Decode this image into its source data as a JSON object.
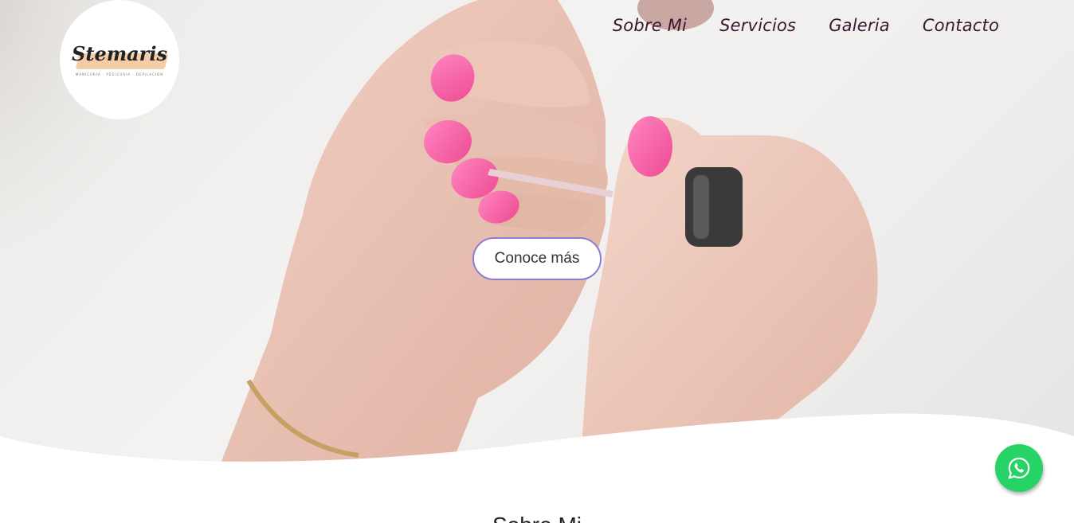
{
  "logo": {
    "wordmark": "Stemaris",
    "tagline": "MANICURIA · PEDICURIA · DEPILACION"
  },
  "nav": {
    "items": [
      {
        "label": "Sobre Mi"
      },
      {
        "label": "Servicios"
      },
      {
        "label": "Galeria"
      },
      {
        "label": "Contacto"
      }
    ]
  },
  "hero": {
    "cta_label": "Conoce más"
  },
  "next_section": {
    "title": "Sobre Mi"
  },
  "floating": {
    "whatsapp_icon": "whatsapp-icon"
  },
  "colors": {
    "nav_text": "#3b1730",
    "cta_border": "#8e7bd3",
    "whatsapp": "#25d366",
    "nail_pink": "#f0569a"
  }
}
